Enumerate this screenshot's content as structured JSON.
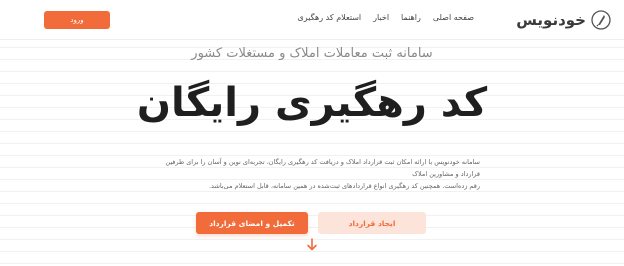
{
  "header": {
    "brand": "خودنویس",
    "nav": [
      {
        "label": "صفحه اصلی"
      },
      {
        "label": "راهنما"
      },
      {
        "label": "اخبار"
      },
      {
        "label": "استعلام کد رهگیری"
      }
    ],
    "login_label": "ورود",
    "brand_icon": "feather-pen-icon"
  },
  "hero": {
    "subtitle": "سامانه ثبت معاملات املاک و مستغلات کشور",
    "headline": "کد رهگیری رایگان",
    "description_line1": "سامانه خودنویس با ارائه امکان ثبت قرارداد املاک و دریافت کد رهگیری رایگان، تجربه‌ای نوین و آسان را برای طرفین قرارداد و مشاورین املاک",
    "description_line2": "رقم زده‌است. همچنین کد رهگیری انواع قراردادهای ثبت‌شده در همین سامانه، قابل استعلام می‌باشد."
  },
  "actions": {
    "create_label": "ایجاد قرارداد",
    "complete_label": "تکمیل و امضای قرارداد",
    "scroll_icon": "arrow-down-icon"
  },
  "colors": {
    "accent": "#f26b3a",
    "accent_light": "#fde4da",
    "headline": "#1f1f1f"
  }
}
